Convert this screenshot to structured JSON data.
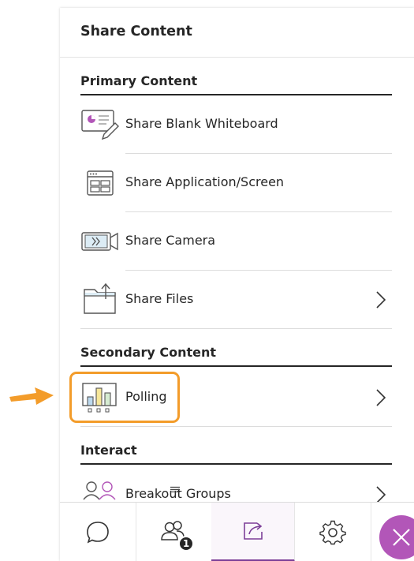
{
  "panel": {
    "title": "Share Content"
  },
  "sections": {
    "primary": "Primary Content",
    "secondary": "Secondary Content",
    "interact": "Interact"
  },
  "items": {
    "whiteboard": "Share Blank Whiteboard",
    "application": "Share Application/Screen",
    "camera": "Share Camera",
    "files": "Share Files",
    "polling": "Polling",
    "breakout": "Breakout Groups"
  },
  "bottom_bar": {
    "attendees_badge": "1",
    "active_tab": "share-content"
  },
  "colors": {
    "accent": "#7c3f98",
    "highlight": "#f39c2a",
    "close_fab": "#b256b8",
    "text": "#262626"
  }
}
